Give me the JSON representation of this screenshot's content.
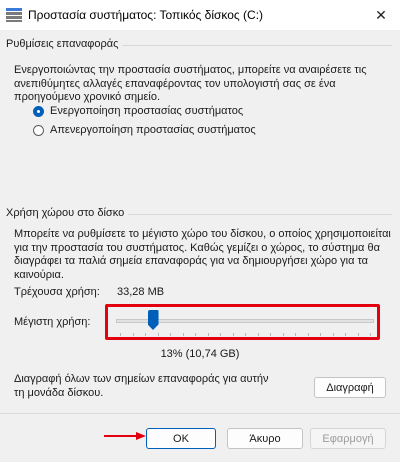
{
  "window": {
    "title": "Προστασία συστήματος: Τοπικός δίσκος (C:)",
    "close_glyph": "✕"
  },
  "restore_settings": {
    "heading": "Ρυθμίσεις επαναφοράς",
    "description_lines": [
      "Ενεργοποιώντας την προστασία συστήματος, μπορείτε να αναιρέσετε τις",
      "ανεπιθύμητες αλλαγές επαναφέροντας τον υπολογιστή σας σε ένα",
      "προηγούμενο χρονικό σημείο."
    ],
    "options": [
      {
        "label": "Ενεργοποίηση προστασίας συστήματος",
        "selected": true
      },
      {
        "label": "Απενεργοποίηση προστασίας συστήματος",
        "selected": false
      }
    ]
  },
  "disk_usage": {
    "heading": "Χρήση χώρου στο δίσκο",
    "description_lines": [
      "Μπορείτε να ρυθμίσετε το μέγιστο χώρο του δίσκου, ο οποίος χρησιμοποιείται",
      "για την προστασία του συστήματος. Καθώς γεμίζει  ο χώρος, το σύστημα θα",
      "διαγράφει τα παλιά σημεία επαναφοράς για να δημιουργήσει χώρο για τα",
      "καινούρια."
    ],
    "current_usage_label": "Τρέχουσα χρήση:",
    "current_usage_value": "33,28 MB",
    "max_usage_label": "Μέγιστη χρήση:",
    "max_usage_percent": 13,
    "max_usage_text": "13% (10,74 GB)",
    "delete_description_lines": [
      "Διαγραφή όλων των σημείων επαναφοράς για αυτήν",
      "τη μονάδα δίσκου."
    ],
    "delete_button": "Διαγραφή"
  },
  "footer": {
    "ok": "OK",
    "cancel": "Άκυρο",
    "apply": "Εφαρμογή"
  },
  "colors": {
    "accent": "#005fb8",
    "highlight_red": "#e3000f"
  }
}
